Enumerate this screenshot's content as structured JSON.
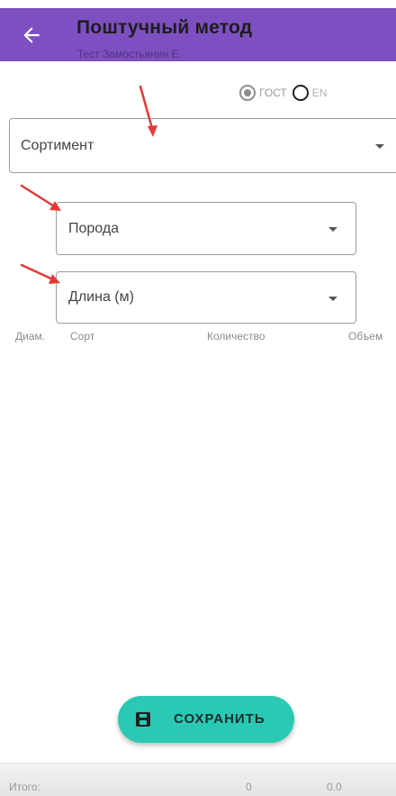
{
  "appbar": {
    "title": "Поштучный метод",
    "subtitle": "Тест Замостьянин Е."
  },
  "standard": {
    "options": [
      "ГОСТ",
      "EN"
    ],
    "selected": "ГОСТ"
  },
  "fields": {
    "sortiment": "Сортимент",
    "poroda": "Порода",
    "dlina": "Длина (м)"
  },
  "table": {
    "columns": [
      "Диам.",
      "Сорт",
      "Количество",
      "Объем"
    ]
  },
  "save_label": "СОХРАНИТЬ",
  "footer": {
    "label": "Итого:",
    "count": "0",
    "volume": "0.0"
  },
  "colors": {
    "appbar": "#7e4fc0",
    "save_button": "#2ac9b4",
    "annotation_arrow": "#e23a3a"
  }
}
